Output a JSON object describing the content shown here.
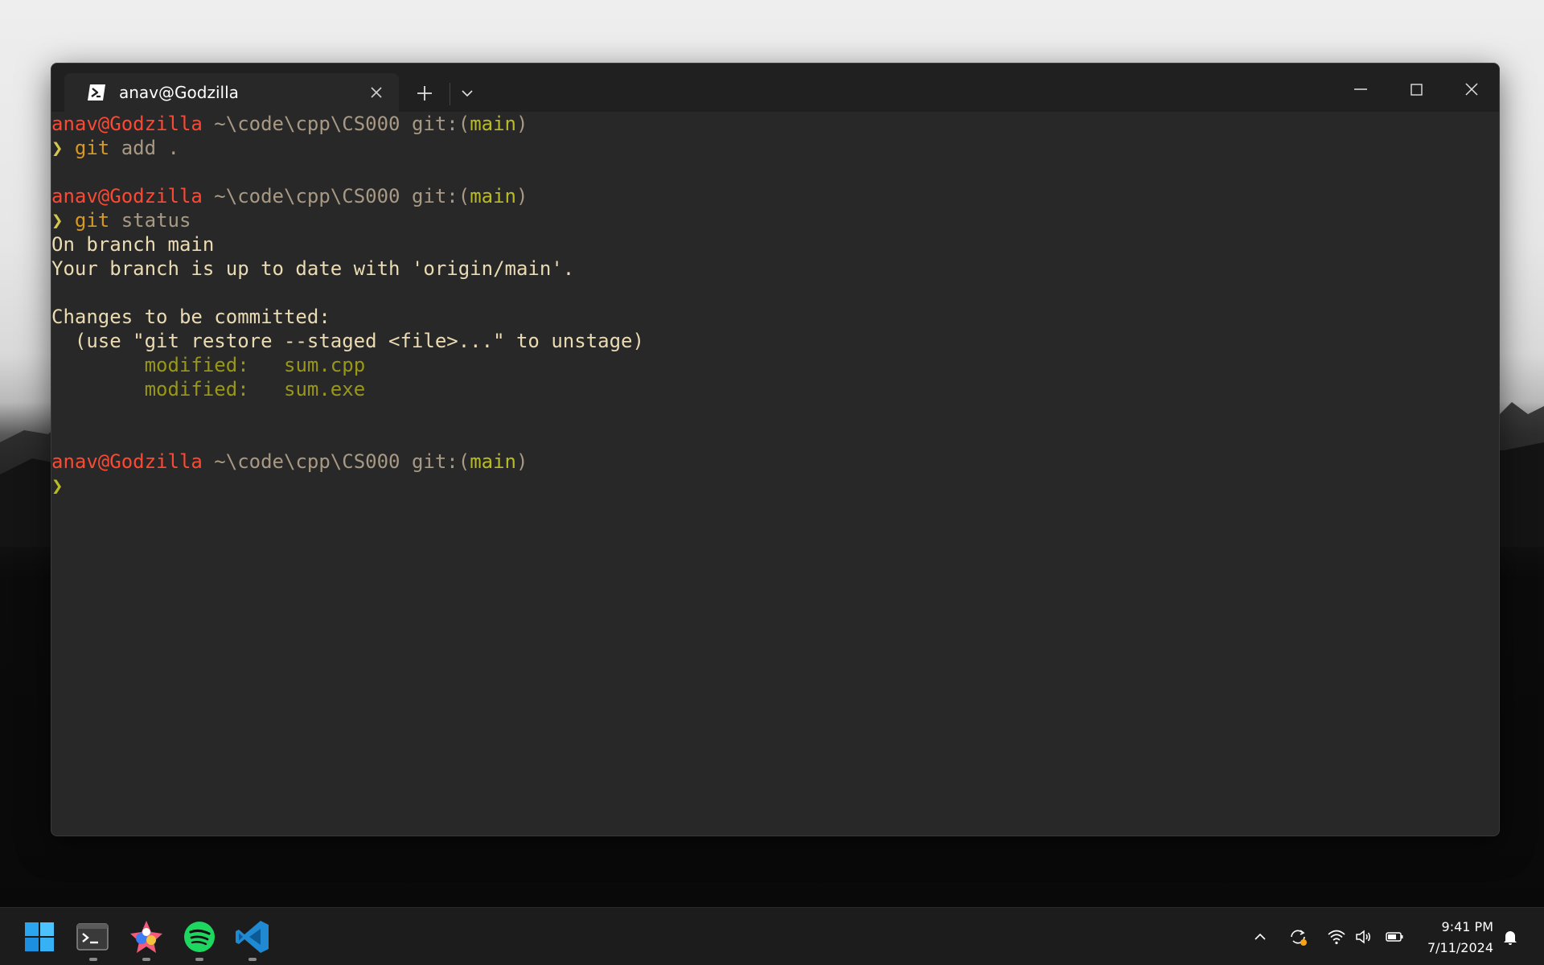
{
  "window": {
    "tab_title": "anav@Godzilla",
    "background": "#282828",
    "titlebar_color": "#202020"
  },
  "terminal": {
    "prompt_user": "anav@Godzilla",
    "prompt_path": "~\\code\\cpp\\CS000",
    "prompt_git": "git:(",
    "prompt_branch": "main",
    "prompt_git_close": ")",
    "prompt_symbol": "❯",
    "cmd1_program": "git",
    "cmd1_args": "add .",
    "cmd2_program": "git",
    "cmd2_args": "status",
    "output": {
      "line1": "On branch main",
      "line2": "Your branch is up to date with 'origin/main'.",
      "line3": "Changes to be committed:",
      "line4": "  (use \"git restore --staged <file>...\" to unstage)",
      "modified_label": "modified:",
      "files": [
        "sum.cpp",
        "sum.exe"
      ]
    },
    "colors": {
      "user": "#fb4934",
      "path": "#a89984",
      "branch": "#b8bb26",
      "command": "#d79921",
      "modified": "#98971a",
      "text": "#ebdbb2"
    }
  },
  "taskbar": {
    "apps": [
      "start-icon",
      "terminal-icon",
      "paint-icon",
      "spotify-icon",
      "vscode-icon"
    ],
    "tray": [
      "chevron-up-icon",
      "sync-icon",
      "wifi-icon",
      "volume-icon",
      "battery-icon",
      "bell-icon"
    ],
    "time": "9:41 PM",
    "date": "7/11/2024"
  }
}
